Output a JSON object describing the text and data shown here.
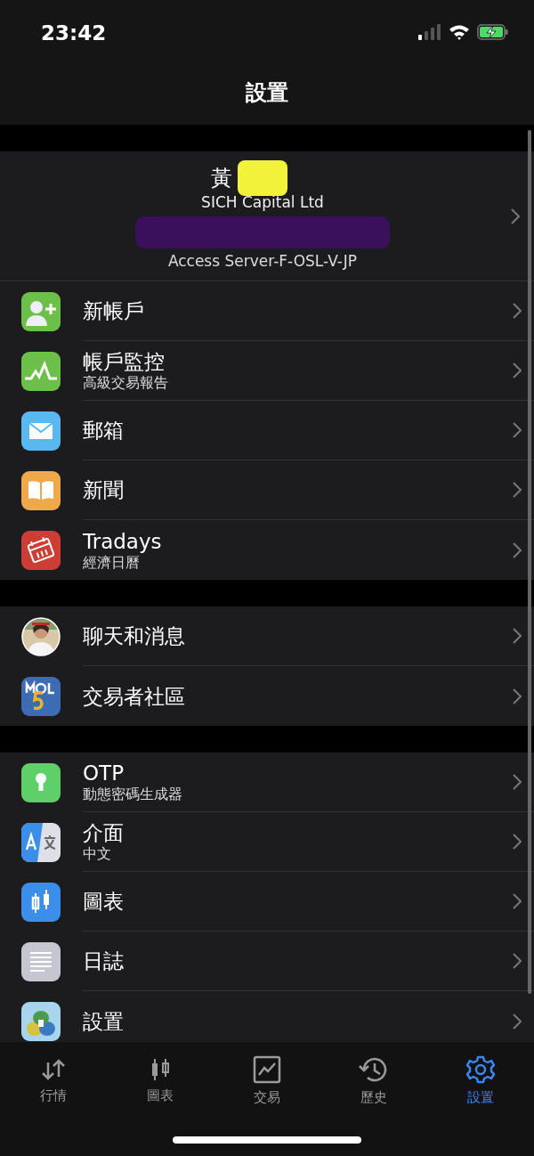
{
  "status_bar": {
    "time": "23:42"
  },
  "nav": {
    "title": "設置"
  },
  "account": {
    "name": "黃",
    "company": "SICH Capital Ltd",
    "server": "Access Server-F-OSL-V-JP"
  },
  "sections": [
    [
      {
        "kind": "add-user",
        "title": "新帳戶"
      },
      {
        "kind": "monitor",
        "title": "帳戶監控",
        "subtitle": "高級交易報告"
      },
      {
        "kind": "mail",
        "title": "郵箱"
      },
      {
        "kind": "news",
        "title": "新聞"
      },
      {
        "kind": "calendar",
        "title": "Tradays",
        "subtitle": "經濟日曆"
      }
    ],
    [
      {
        "kind": "avatar",
        "title": "聊天和消息"
      },
      {
        "kind": "mql",
        "title": "交易者社區"
      }
    ],
    [
      {
        "kind": "otp",
        "title": "OTP",
        "subtitle": "動態密碼生成器"
      },
      {
        "kind": "language",
        "title": "介面",
        "subtitle": "中文"
      },
      {
        "kind": "chart",
        "title": "圖表"
      },
      {
        "kind": "journal",
        "title": "日誌"
      },
      {
        "kind": "app",
        "title": "設置"
      }
    ]
  ],
  "tabs": [
    {
      "kind": "quotes",
      "label": "行情",
      "selected": false
    },
    {
      "kind": "chart",
      "label": "圖表",
      "selected": false
    },
    {
      "kind": "trade",
      "label": "交易",
      "selected": false
    },
    {
      "kind": "history",
      "label": "歷史",
      "selected": false
    },
    {
      "kind": "settings",
      "label": "設置",
      "selected": true
    }
  ]
}
